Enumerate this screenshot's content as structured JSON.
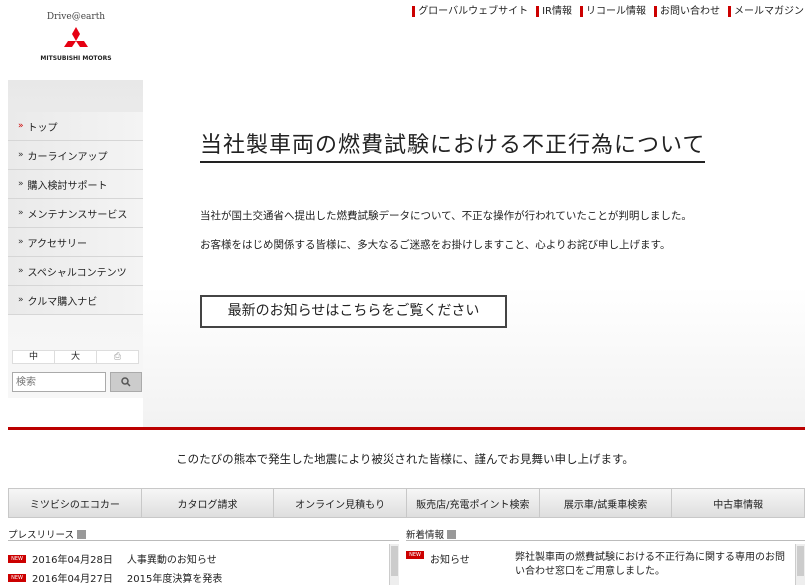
{
  "topnav": [
    "グローバルウェブサイト",
    "IR情報",
    "リコール情報",
    "お問い合わせ",
    "メールマガジン"
  ],
  "logo": {
    "tagline": "Drive@earth",
    "brand": "MITSUBISHI MOTORS"
  },
  "sidebar": {
    "items": [
      "トップ",
      "カーラインアップ",
      "購入検討サポート",
      "メンテナンスサービス",
      "アクセサリー",
      "スペシャルコンテンツ",
      "クルマ購入ナビ"
    ],
    "font_sizes": [
      "中",
      "大"
    ],
    "search_placeholder": "検索"
  },
  "hero": {
    "title": "当社製車両の燃費試験における不正行為について",
    "p1": "当社が国土交通省へ提出した燃費試験データについて、不正な操作が行われていたことが判明しました。",
    "p2": "お客様をはじめ関係する皆様に、多大なるご迷惑をお掛けしますこと、心よりお詫び申し上げます。",
    "button": "最新のお知らせはこちらをご覧ください"
  },
  "condolence": "このたびの熊本で発生した地震により被災された皆様に、謹んでお見舞い申し上げます。",
  "tabs": [
    "ミツビシのエコカー",
    "カタログ請求",
    "オンライン見積もり",
    "販売店/充電ポイント検索",
    "展示車/試乗車検索",
    "中古車情報"
  ],
  "press": {
    "title": "プレスリリース",
    "rows": [
      {
        "date": "2016年04月28日",
        "text": "人事異動のお知らせ"
      },
      {
        "date": "2016年04月27日",
        "text": "2015年度決算を発表"
      }
    ]
  },
  "news": {
    "title": "新着情報",
    "rows": [
      {
        "type": "お知らせ",
        "text": "弊社製車両の燃費試験における不正行為に関する専用のお問い合わせ窓口をご用意しました。"
      }
    ]
  },
  "new_badge": "NEW",
  "colors": {
    "accent": "#cc0000",
    "brand_red": "#e60012"
  }
}
